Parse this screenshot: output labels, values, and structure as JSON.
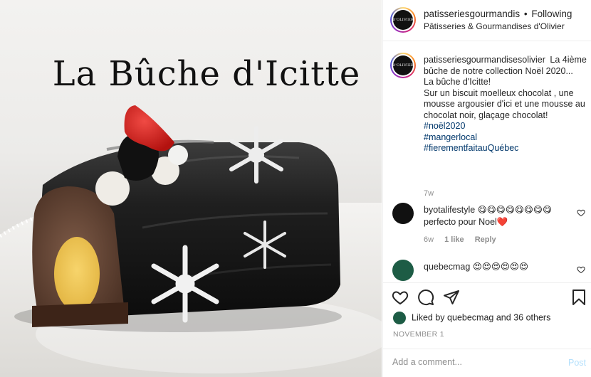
{
  "photo": {
    "title": "La Bûche d'Icitte"
  },
  "header": {
    "username": "patisseriesgourmandis",
    "separator": "•",
    "follow_label": "Following",
    "subtitle": "Pâtisseries & Gourmandises d'Olivier",
    "avatar_text": "D'OLIVIER"
  },
  "caption": {
    "username": "patisseriesgourmandisesolivier",
    "text_lines": [
      "La 4ième bûche de notre collection Noël 2020...",
      "La bûche d'Icitte!",
      "Sur un biscuit moelleux chocolat , une mousse argousier d'ici et une mousse au chocolat noir, glaçage chocolat!"
    ],
    "hashtags": [
      "#noël2020",
      "#mangerlocal",
      "#fierementfaitauQuébec"
    ],
    "age": "7w"
  },
  "comments": [
    {
      "username": "byotalifestyle",
      "text": "😋😋😋😋😋😋😋😋perfecto pour Noel❤️",
      "age": "6w",
      "likes": "1 like",
      "reply_label": "Reply",
      "avatar_color": "#111111"
    },
    {
      "username": "quebecmag",
      "text": "😍😍😍😍😍😍",
      "avatar_color": "#1d5c45"
    }
  ],
  "actions": {
    "liked_prefix": "Liked by",
    "liked_user": "quebecmag",
    "liked_and": "and",
    "liked_others": "36 others",
    "date": "NOVEMBER 1",
    "comment_placeholder": "Add a comment...",
    "post_label": "Post"
  },
  "icons": [
    "heart-icon",
    "comment-icon",
    "share-icon",
    "bookmark-icon"
  ],
  "colors": {
    "link": "#00376b",
    "meta": "#8e8e8e",
    "post_disabled": "#b2dffc",
    "heart_red": "#ed4956"
  }
}
